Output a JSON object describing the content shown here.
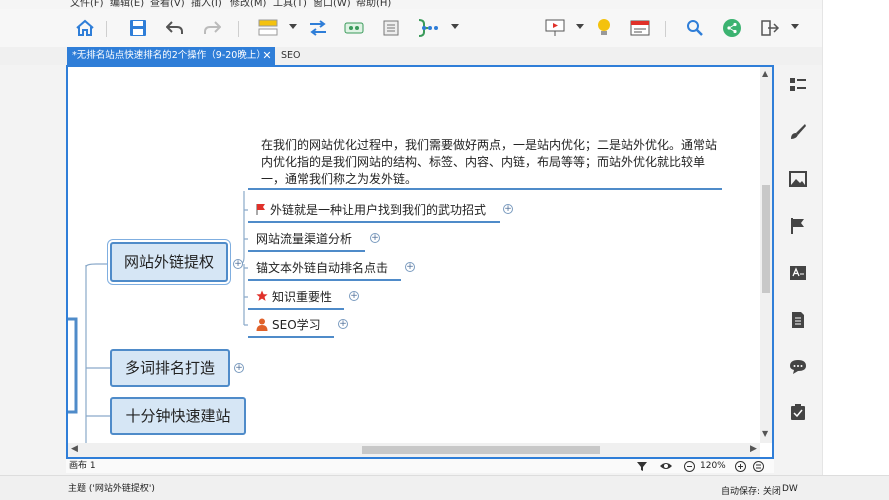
{
  "menu": [
    "文件(F)",
    "编辑(E)",
    "查看(V)",
    "插入(I)",
    "修改(M)",
    "工具(T)",
    "窗口(W)",
    "帮助(H)"
  ],
  "tabs": {
    "active": "*无排名站点快速排名的2个操作（9-20晚上）",
    "close": "✕",
    "other": "SEO"
  },
  "mindmap": {
    "note": "在我们的网站优化过程中，我们需要做好两点，一是站内优化；二是站外优化。通常站内优化指的是我们网站的结构、标签、内容、内链，布局等等；而站外优化就比较单一，通常我们称之为发外链。",
    "topics": {
      "t1": "网站外链提权",
      "t2": "多词排名打造",
      "t3": "十分钟快速建站"
    },
    "leaves": [
      {
        "label": "外链就是一种让用户找到我们的武功招式",
        "icon": "flag-icon"
      },
      {
        "label": "网站流量渠道分析",
        "icon": ""
      },
      {
        "label": "锚文本外链自动排名点击",
        "icon": ""
      },
      {
        "label": "知识重要性",
        "icon": "star-icon"
      },
      {
        "label": "SEO学习",
        "icon": "person-icon"
      }
    ],
    "plus": "+"
  },
  "status": {
    "sheet": "画布 1",
    "zoom": "120%"
  },
  "info": {
    "topic": "主题 ('网站外链提权')",
    "autosave": "自动保存: 关闭",
    "account": "DW"
  },
  "colors": {
    "accent": "#2f7ed8",
    "topic_fill": "#d6e6f5",
    "topic_border": "#4f8bc9",
    "flag": "#e0312a",
    "star": "#e0312a",
    "person": "#e0612a",
    "bulb": "#f4c20d",
    "share": "#3cb371"
  }
}
